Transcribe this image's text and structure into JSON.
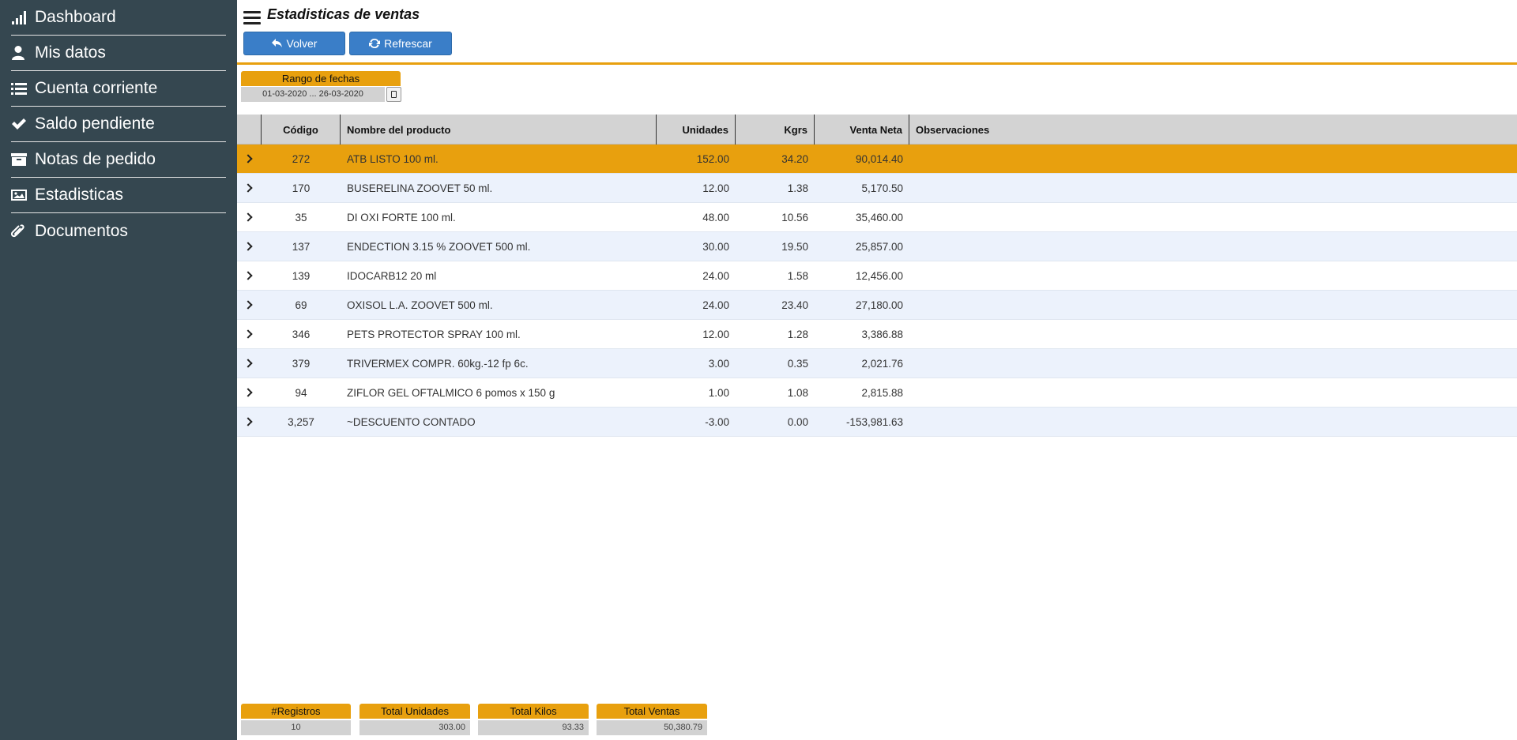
{
  "sidebar": {
    "items": [
      {
        "label": "Dashboard",
        "icon": "signal-bars-icon"
      },
      {
        "label": "Mis datos",
        "icon": "user-icon"
      },
      {
        "label": "Cuenta corriente",
        "icon": "list-icon"
      },
      {
        "label": "Saldo pendiente",
        "icon": "check-icon"
      },
      {
        "label": "Notas de pedido",
        "icon": "archive-icon"
      },
      {
        "label": "Estadisticas",
        "icon": "image-icon"
      },
      {
        "label": "Documentos",
        "icon": "paperclip-icon"
      }
    ]
  },
  "header": {
    "title": "Estadisticas de ventas",
    "back_label": "Volver",
    "refresh_label": "Refrescar"
  },
  "filters": {
    "date_range_label": "Rango de fechas",
    "date_range_value": "01-03-2020 ... 26-03-2020"
  },
  "table": {
    "columns": [
      "",
      "Código",
      "Nombre del producto",
      "Unidades",
      "Kgrs",
      "Venta Neta",
      "Observaciones"
    ],
    "selected_row": 0,
    "rows": [
      {
        "code": "272",
        "name": "ATB LISTO 100 ml.",
        "units": "152.00",
        "kg": "34.20",
        "net": "90,014.40",
        "obs": ""
      },
      {
        "code": "170",
        "name": "BUSERELINA ZOOVET 50 ml.",
        "units": "12.00",
        "kg": "1.38",
        "net": "5,170.50",
        "obs": ""
      },
      {
        "code": "35",
        "name": "DI OXI FORTE 100 ml.",
        "units": "48.00",
        "kg": "10.56",
        "net": "35,460.00",
        "obs": ""
      },
      {
        "code": "137",
        "name": "ENDECTION 3.15 % ZOOVET 500 ml.",
        "units": "30.00",
        "kg": "19.50",
        "net": "25,857.00",
        "obs": ""
      },
      {
        "code": "139",
        "name": "IDOCARB12 20 ml",
        "units": "24.00",
        "kg": "1.58",
        "net": "12,456.00",
        "obs": ""
      },
      {
        "code": "69",
        "name": "OXISOL L.A. ZOOVET 500 ml.",
        "units": "24.00",
        "kg": "23.40",
        "net": "27,180.00",
        "obs": ""
      },
      {
        "code": "346",
        "name": "PETS PROTECTOR SPRAY 100 ml.",
        "units": "12.00",
        "kg": "1.28",
        "net": "3,386.88",
        "obs": ""
      },
      {
        "code": "379",
        "name": "TRIVERMEX COMPR. 60kg.-12 fp 6c.",
        "units": "3.00",
        "kg": "0.35",
        "net": "2,021.76",
        "obs": ""
      },
      {
        "code": "94",
        "name": "ZIFLOR GEL OFTALMICO 6 pomos x 150 g",
        "units": "1.00",
        "kg": "1.08",
        "net": "2,815.88",
        "obs": ""
      },
      {
        "code": "3,257",
        "name": "~DESCUENTO CONTADO",
        "units": "-3.00",
        "kg": "0.00",
        "net": "-153,981.63",
        "obs": ""
      }
    ]
  },
  "totals": {
    "records_label": "#Registros",
    "records_value": "10",
    "units_label": "Total Unidades",
    "units_value": "303.00",
    "kilos_label": "Total Kilos",
    "kilos_value": "93.33",
    "sales_label": "Total Ventas",
    "sales_value": "50,380.79"
  },
  "colors": {
    "sidebar_bg": "#354750",
    "accent": "#e8a00e",
    "button_blue": "#3a7ec8",
    "row_alt": "#ecf2fc",
    "header_gray": "#d3d3d3"
  }
}
